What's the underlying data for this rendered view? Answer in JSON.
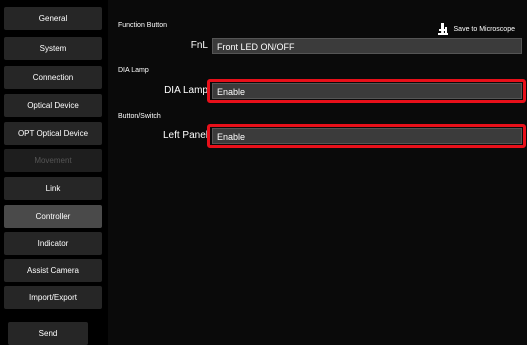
{
  "sidebar": {
    "items": [
      {
        "label": "General"
      },
      {
        "label": "System"
      },
      {
        "label": "Connection"
      },
      {
        "label": "Optical Device"
      },
      {
        "label": "OPT Optical Device"
      },
      {
        "label": "Movement"
      },
      {
        "label": "Link"
      },
      {
        "label": "Controller"
      },
      {
        "label": "Indicator"
      },
      {
        "label": "Assist Camera"
      },
      {
        "label": "Import/Export"
      }
    ],
    "send_label": "Send"
  },
  "main": {
    "function_button": {
      "section": "Function Button",
      "label": "FnL",
      "value": "Front LED ON/OFF"
    },
    "save_label": "Save to Microscope",
    "dia_lamp": {
      "section": "DIA Lamp",
      "label": "DIA Lamp",
      "value": "Enable"
    },
    "button_switch": {
      "section": "Button/Switch",
      "label": "Left Panel",
      "value": "Enable"
    }
  },
  "colors": {
    "highlight": "#e8101a",
    "field_bg": "#3b3b3b"
  },
  "icons": {
    "save": "microscope-icon"
  }
}
